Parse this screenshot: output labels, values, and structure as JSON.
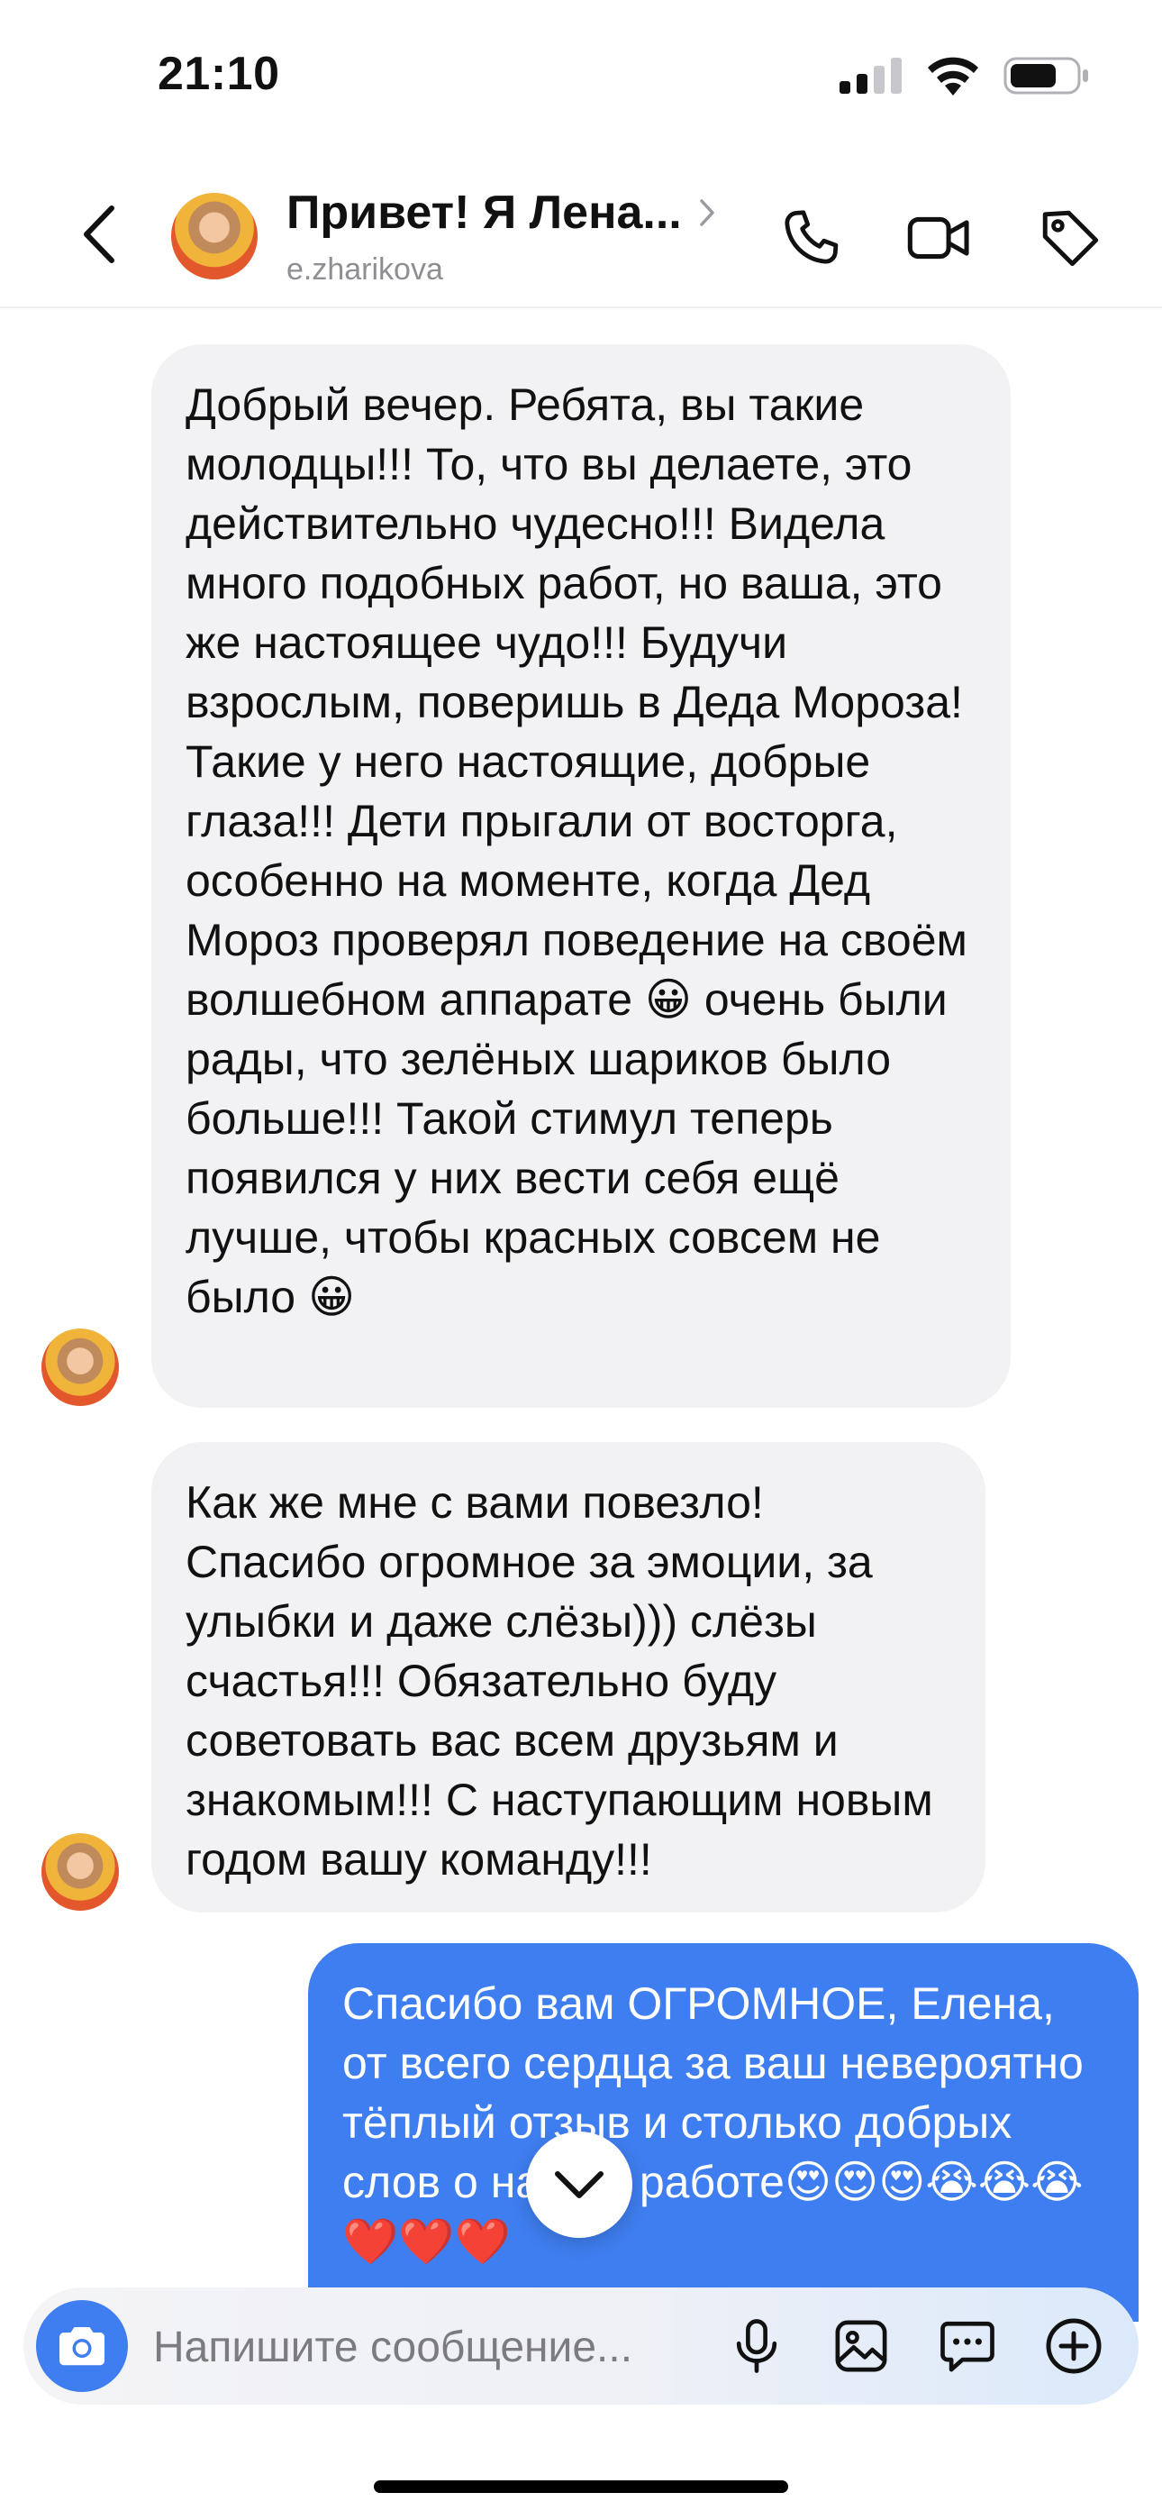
{
  "status_bar": {
    "time": "21:10"
  },
  "header": {
    "title": "Привет! Я Лена...",
    "username": "e.zharikova"
  },
  "messages": [
    {
      "direction": "incoming",
      "text": "Добрый вечер. Ребята, вы такие молодцы!!! То, что вы делаете, это действительно чудесно!!! Видела много подобных работ, но ваша, это же настоящее чудо!!! Будучи взрослым, поверишь в Деда Мороза! Такие у него настоящие, добрые глаза!!! Дети прыгали от восторга, особенно на моменте, когда Дед Мороз проверял поведение на своём волшебном аппарате 😀 очень были рады, что зелёных шариков было больше!!! Такой стимул теперь появился у них вести себя ещё лучше, чтобы красных совсем не было 😀"
    },
    {
      "direction": "incoming",
      "text": "Как же мне с вами повезло! Спасибо огромное за эмоции, за улыбки и даже слёзы))) слёзы счастья!!! Обязательно буду советовать вас всем друзьям и знакомым!!! С наступающим новым годом вашу команду!!!"
    },
    {
      "direction": "outgoing",
      "text": "Спасибо вам ОГРОМНОЕ, Елена, от всего сердца за ваш невероятно тёплый отзыв и столько добрых слов о нашей работе😍😍😍😭😭😭❤️❤️❤️"
    }
  ],
  "composer": {
    "placeholder": "Напишите сообщение..."
  },
  "colors": {
    "accent": "#3f7ef0",
    "incoming_bubble": "#f2f2f4",
    "outgoing_text": "#ffffff"
  },
  "icons": [
    "back-icon",
    "chevron-right-icon",
    "phone-icon",
    "video-camera-icon",
    "tag-icon",
    "chevron-down-icon",
    "camera-icon",
    "microphone-icon",
    "image-icon",
    "sticker-icon",
    "plus-icon"
  ]
}
